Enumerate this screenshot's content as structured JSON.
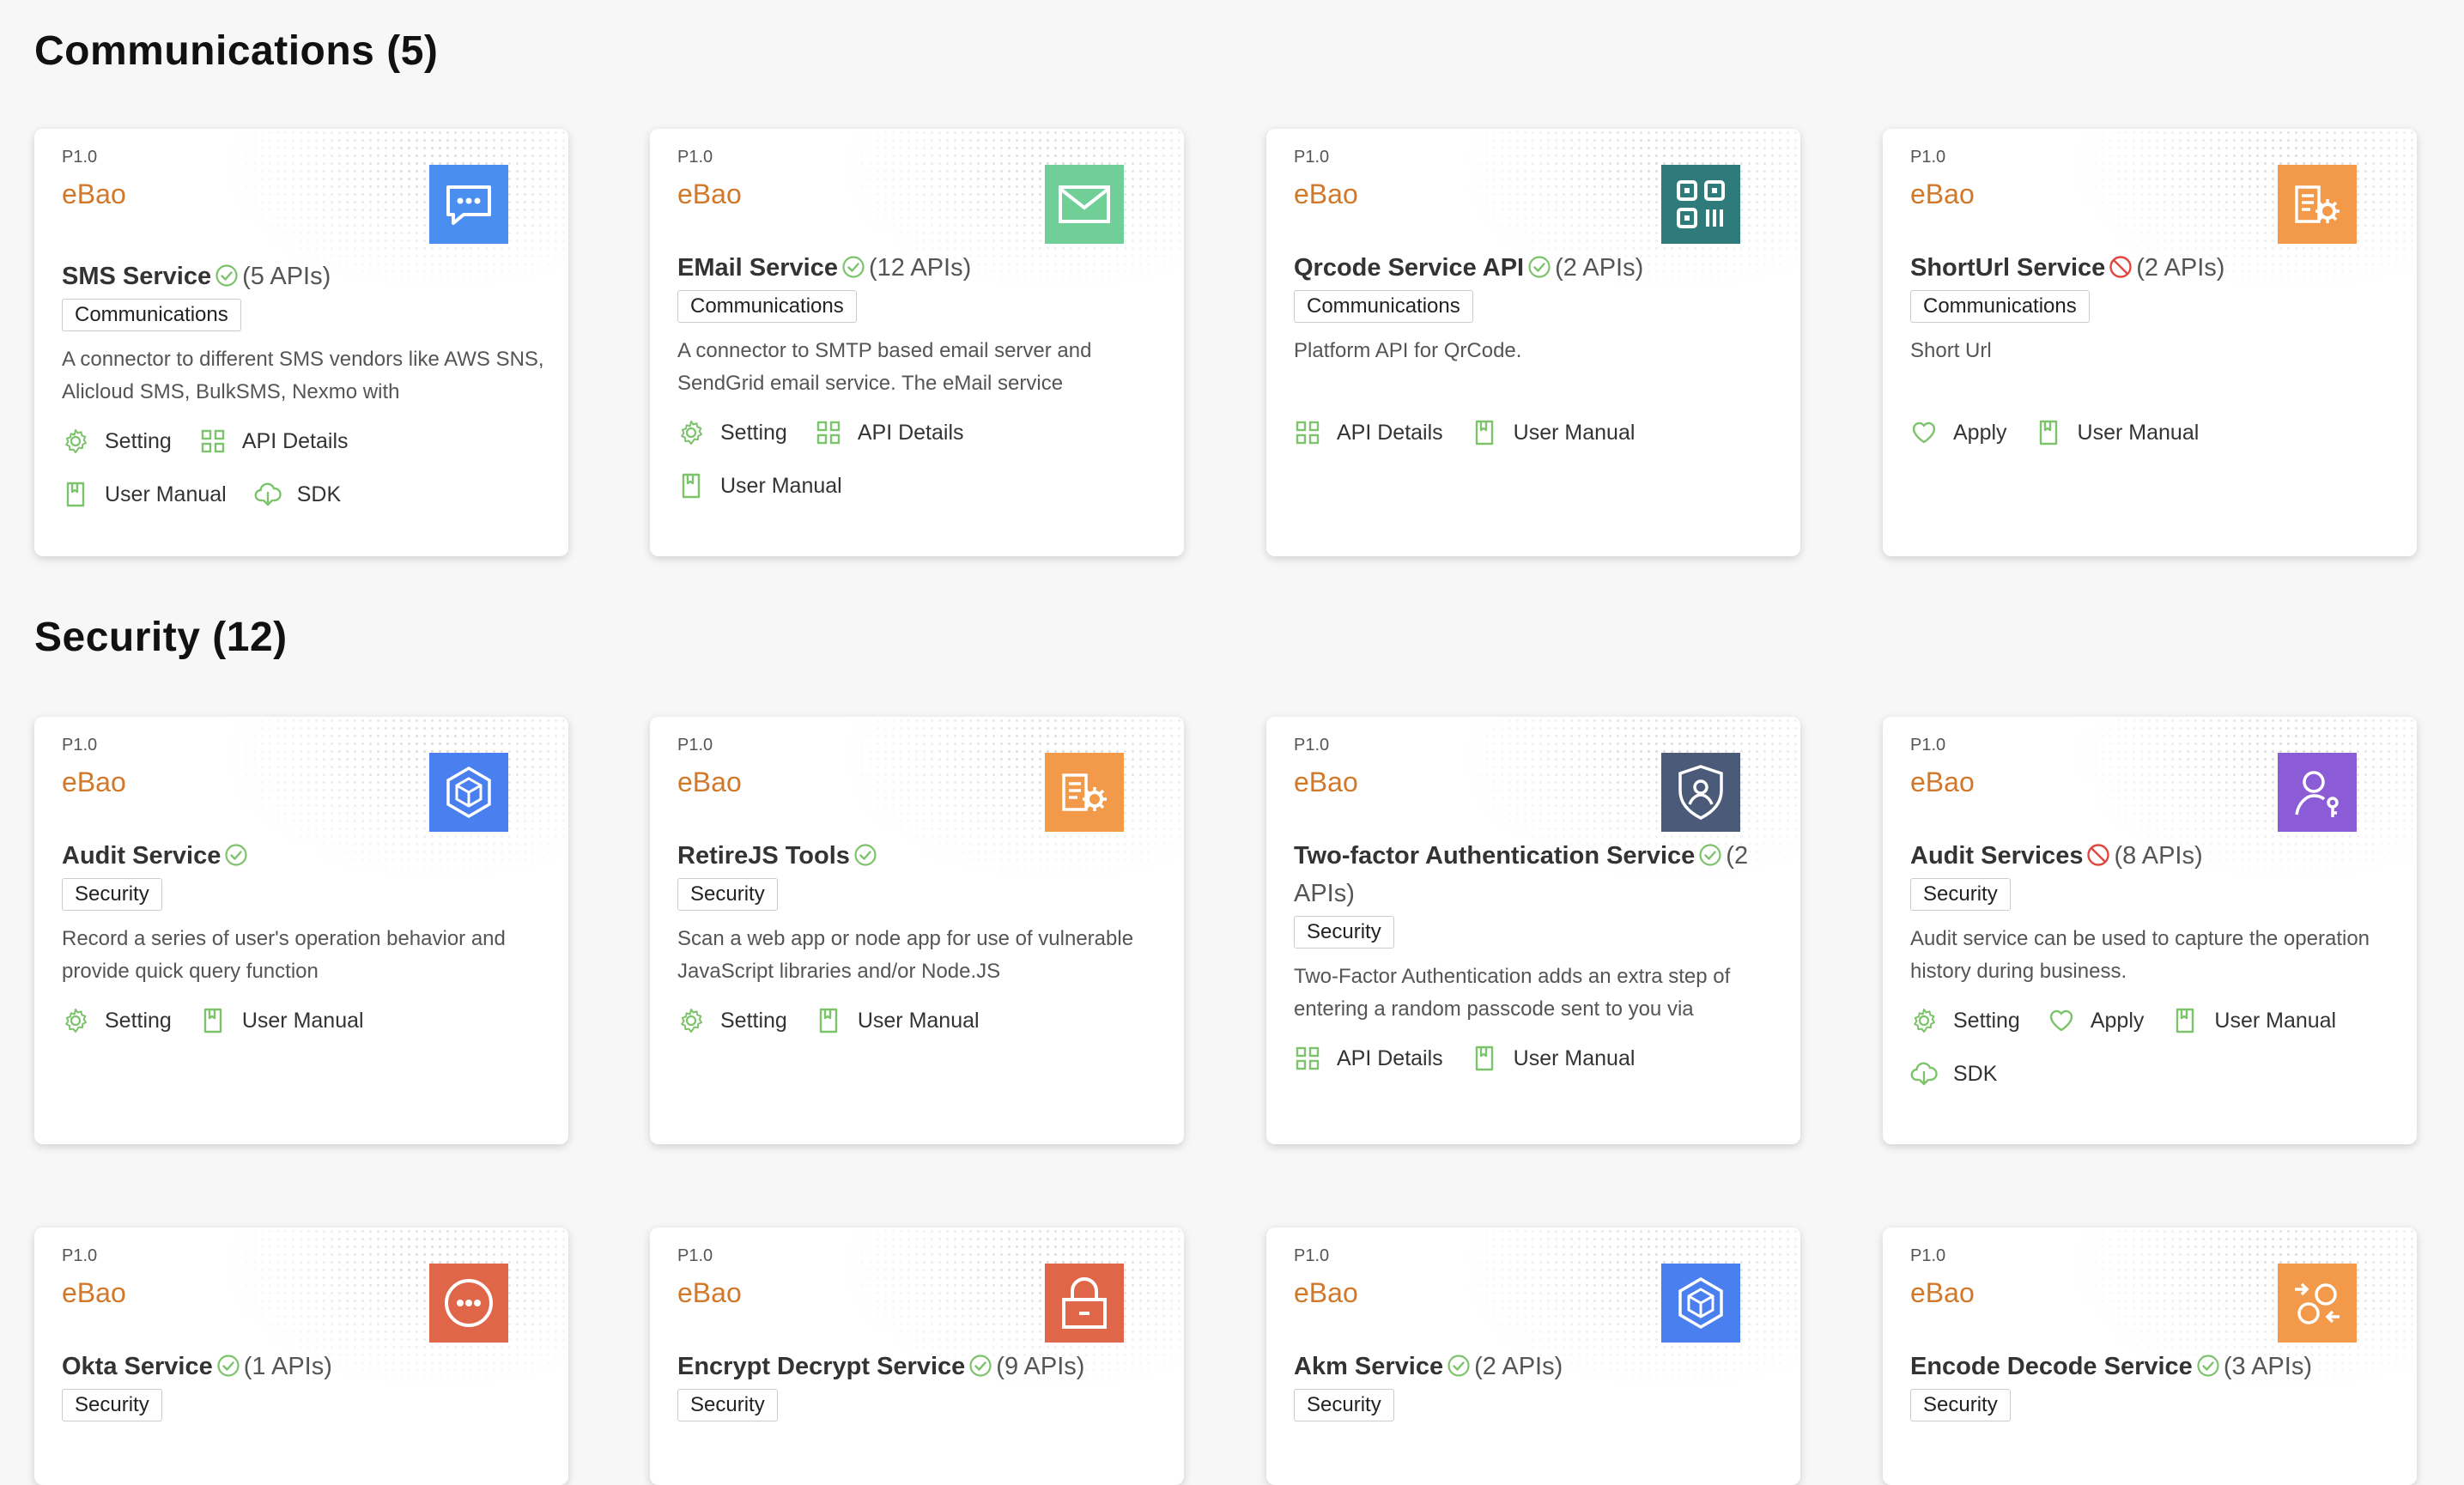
{
  "sections": [
    {
      "title": "Communications (5)",
      "cards": [
        {
          "version": "P1.0",
          "vendor": "eBao",
          "name": "SMS Service",
          "status": "ok",
          "apis": "(5 APIs)",
          "tag": "Communications",
          "desc": "A connector to different SMS vendors like AWS SNS, Alicloud SMS, BulkSMS, Nexmo with",
          "logo": "chat-icon",
          "color": "#4a8ff0",
          "actions": [
            {
              "label": "Setting",
              "icon": "gear-icon"
            },
            {
              "label": "API Details",
              "icon": "grid-icon"
            },
            {
              "label": "User Manual",
              "icon": "book-icon"
            },
            {
              "label": "SDK",
              "icon": "cloud-download-icon"
            }
          ]
        },
        {
          "version": "P1.0",
          "vendor": "eBao",
          "name": "EMail Service",
          "status": "ok",
          "apis": "(12 APIs)",
          "tag": "Communications",
          "desc": "A connector to SMTP based email server and SendGrid email service. The eMail service",
          "logo": "mail-icon",
          "color": "#6fcf97",
          "actions": [
            {
              "label": "Setting",
              "icon": "gear-icon"
            },
            {
              "label": "API Details",
              "icon": "grid-icon"
            },
            {
              "label": "User Manual",
              "icon": "book-icon"
            }
          ]
        },
        {
          "version": "P1.0",
          "vendor": "eBao",
          "name": "Qrcode Service API",
          "status": "ok",
          "apis": "(2 APIs)",
          "tag": "Communications",
          "desc": "Platform API for QrCode.",
          "logo": "qrcode-icon",
          "color": "#2f7a7a",
          "actions": [
            {
              "label": "API Details",
              "icon": "grid-icon"
            },
            {
              "label": "User Manual",
              "icon": "book-icon"
            }
          ]
        },
        {
          "version": "P1.0",
          "vendor": "eBao",
          "name": "ShortUrl Service",
          "status": "blocked",
          "apis": "(2 APIs)",
          "tag": "Communications",
          "desc": "Short Url",
          "logo": "doc-gear-icon",
          "color": "#f29a4a",
          "actions": [
            {
              "label": "Apply",
              "icon": "heart-icon"
            },
            {
              "label": "User Manual",
              "icon": "book-icon"
            }
          ]
        }
      ]
    },
    {
      "title": "Security (12)",
      "cards": [
        {
          "version": "P1.0",
          "vendor": "eBao",
          "name": "Audit Service",
          "status": "ok",
          "apis": "",
          "tag": "Security",
          "desc": "Record a series of user's operation behavior and provide quick query function",
          "logo": "cube-icon",
          "color": "#4a7ff0",
          "actions": [
            {
              "label": "Setting",
              "icon": "gear-icon"
            },
            {
              "label": "User Manual",
              "icon": "book-icon"
            }
          ]
        },
        {
          "version": "P1.0",
          "vendor": "eBao",
          "name": "RetireJS Tools",
          "status": "ok",
          "apis": "",
          "tag": "Security",
          "desc": "Scan a web app or node app for use of vulnerable JavaScript libraries and/or Node.JS",
          "logo": "doc-gear-icon",
          "color": "#f29a4a",
          "actions": [
            {
              "label": "Setting",
              "icon": "gear-icon"
            },
            {
              "label": "User Manual",
              "icon": "book-icon"
            }
          ]
        },
        {
          "version": "P1.0",
          "vendor": "eBao",
          "name": "Two-factor Authentication Service",
          "status": "ok",
          "apis": "(2 APIs)",
          "tag": "Security",
          "desc": "Two-Factor Authentication adds an extra step of entering a random passcode sent to you via",
          "logo": "shield-user-icon",
          "color": "#4a5a78",
          "actions": [
            {
              "label": "API Details",
              "icon": "grid-icon"
            },
            {
              "label": "User Manual",
              "icon": "book-icon"
            }
          ]
        },
        {
          "version": "P1.0",
          "vendor": "eBao",
          "name": "Audit Services",
          "status": "blocked",
          "apis": "(8 APIs)",
          "tag": "Security",
          "desc": "Audit service can be used to capture the operation history during business.",
          "logo": "user-key-icon",
          "color": "#8b5cd6",
          "actions": [
            {
              "label": "Setting",
              "icon": "gear-icon"
            },
            {
              "label": "Apply",
              "icon": "heart-icon"
            },
            {
              "label": "User Manual",
              "icon": "book-icon"
            },
            {
              "label": "SDK",
              "icon": "cloud-download-icon"
            }
          ]
        },
        {
          "version": "P1.0",
          "vendor": "eBao",
          "name": "Okta Service",
          "status": "ok",
          "apis": "(1 APIs)",
          "tag": "Security",
          "desc": "",
          "logo": "dots-circle-icon",
          "color": "#e0664a",
          "actions": []
        },
        {
          "version": "P1.0",
          "vendor": "eBao",
          "name": "Encrypt Decrypt Service",
          "status": "ok",
          "apis": "(9 APIs)",
          "tag": "Security",
          "desc": "",
          "logo": "lock-icon",
          "color": "#e0664a",
          "actions": []
        },
        {
          "version": "P1.0",
          "vendor": "eBao",
          "name": "Akm Service",
          "status": "ok",
          "apis": "(2 APIs)",
          "tag": "Security",
          "desc": "",
          "logo": "cube-icon",
          "color": "#4a7ff0",
          "actions": []
        },
        {
          "version": "P1.0",
          "vendor": "eBao",
          "name": "Encode Decode Service",
          "status": "ok",
          "apis": "(3 APIs)",
          "tag": "Security",
          "desc": "",
          "logo": "exchange-icon",
          "color": "#f29a4a",
          "actions": []
        }
      ]
    }
  ]
}
